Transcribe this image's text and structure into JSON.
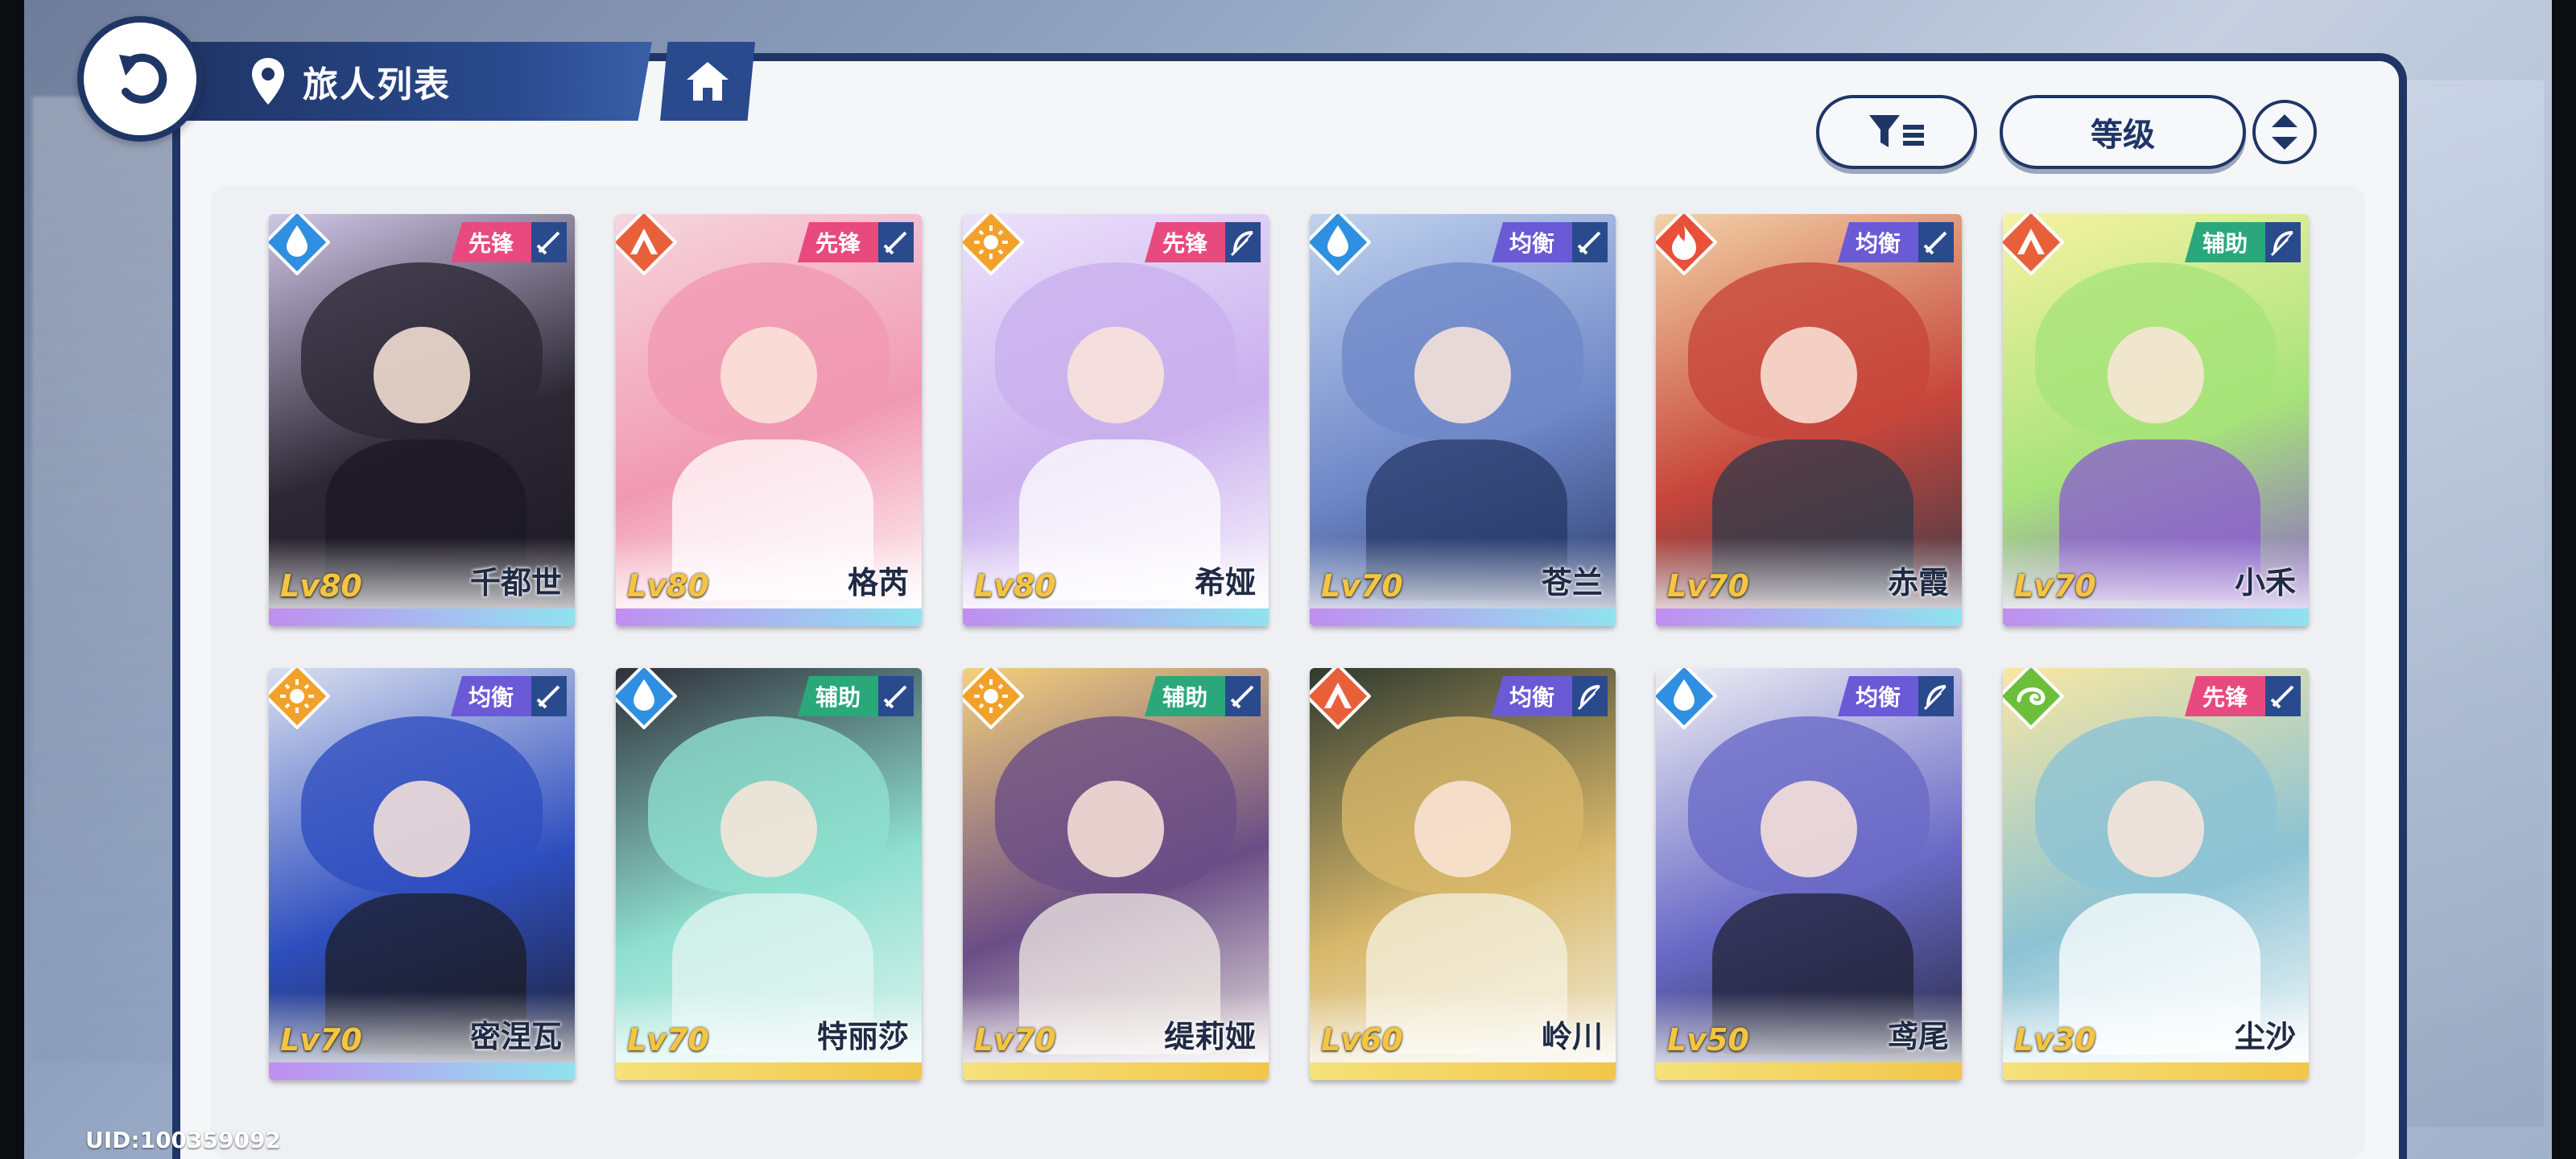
{
  "header": {
    "title": "旅人列表",
    "sort_label": "等级"
  },
  "uid_label": "UID:100359092",
  "cards": [
    {
      "name": "千都世",
      "level": "Lv80",
      "role": "先锋",
      "element": "water",
      "weapon": "sword",
      "role_color": "#e84a7f",
      "colors": [
        "#2b2733",
        "#cfc5e6",
        "#1b1823"
      ]
    },
    {
      "name": "格芮",
      "level": "Lv80",
      "role": "先锋",
      "element": "earth",
      "weapon": "sword",
      "role_color": "#e84a7f",
      "colors": [
        "#f199b3",
        "#f6d6dc",
        "#ffffff"
      ]
    },
    {
      "name": "希娅",
      "level": "Lv80",
      "role": "先锋",
      "element": "light",
      "weapon": "bow",
      "role_color": "#e84a7f",
      "colors": [
        "#c9b0ee",
        "#ece1fb",
        "#ffffff"
      ]
    },
    {
      "name": "苍兰",
      "level": "Lv70",
      "role": "均衡",
      "element": "water",
      "weapon": "sword",
      "role_color": "#6a5ad6",
      "colors": [
        "#6f88c8",
        "#c0d2ee",
        "#243766"
      ]
    },
    {
      "name": "赤霞",
      "level": "Lv70",
      "role": "均衡",
      "element": "fire",
      "weapon": "sword",
      "role_color": "#6a5ad6",
      "colors": [
        "#c7463c",
        "#f2d2a7",
        "#2e3a4a"
      ]
    },
    {
      "name": "小禾",
      "level": "Lv70",
      "role": "辅助",
      "element": "earth",
      "weapon": "bow",
      "role_color": "#2aa87b",
      "colors": [
        "#a7e37a",
        "#f7f2a2",
        "#8a5bd0"
      ]
    },
    {
      "name": "密涅瓦",
      "level": "Lv70",
      "role": "均衡",
      "element": "light",
      "weapon": "sword",
      "role_color": "#6a5ad6",
      "colors": [
        "#2f4fbf",
        "#d9dfef",
        "#1c1c26"
      ]
    },
    {
      "name": "特丽莎",
      "level": "Lv70",
      "role": "辅助",
      "element": "water",
      "weapon": "sword",
      "role_color": "#2aa87b",
      "colors": [
        "#8fe0cf",
        "#2f2f3a",
        "#e5f6f3"
      ]
    },
    {
      "name": "缇莉娅",
      "level": "Lv70",
      "role": "辅助",
      "element": "light",
      "weapon": "sword",
      "role_color": "#2aa87b",
      "colors": [
        "#6a4d86",
        "#f4d07a",
        "#f1ece6"
      ]
    },
    {
      "name": "岭川",
      "level": "Lv60",
      "role": "均衡",
      "element": "earth",
      "weapon": "bow",
      "role_color": "#6a5ad6",
      "colors": [
        "#d8b86a",
        "#2f3a2f",
        "#f5f1e2"
      ]
    },
    {
      "name": "鸢尾",
      "level": "Lv50",
      "role": "均衡",
      "element": "water",
      "weapon": "bow",
      "role_color": "#6a5ad6",
      "colors": [
        "#6a6ac7",
        "#efeff4",
        "#202236"
      ]
    },
    {
      "name": "尘沙",
      "level": "Lv30",
      "role": "先锋",
      "element": "wind",
      "weapon": "sword",
      "role_color": "#e84a7f",
      "colors": [
        "#8cc3d4",
        "#f8e7a3",
        "#ffffff"
      ]
    }
  ],
  "icons": {
    "back": "back-arrow-icon",
    "pin": "map-pin-icon",
    "home": "home-icon",
    "filter": "filter-icon",
    "sort_order": "sort-order-icon"
  }
}
